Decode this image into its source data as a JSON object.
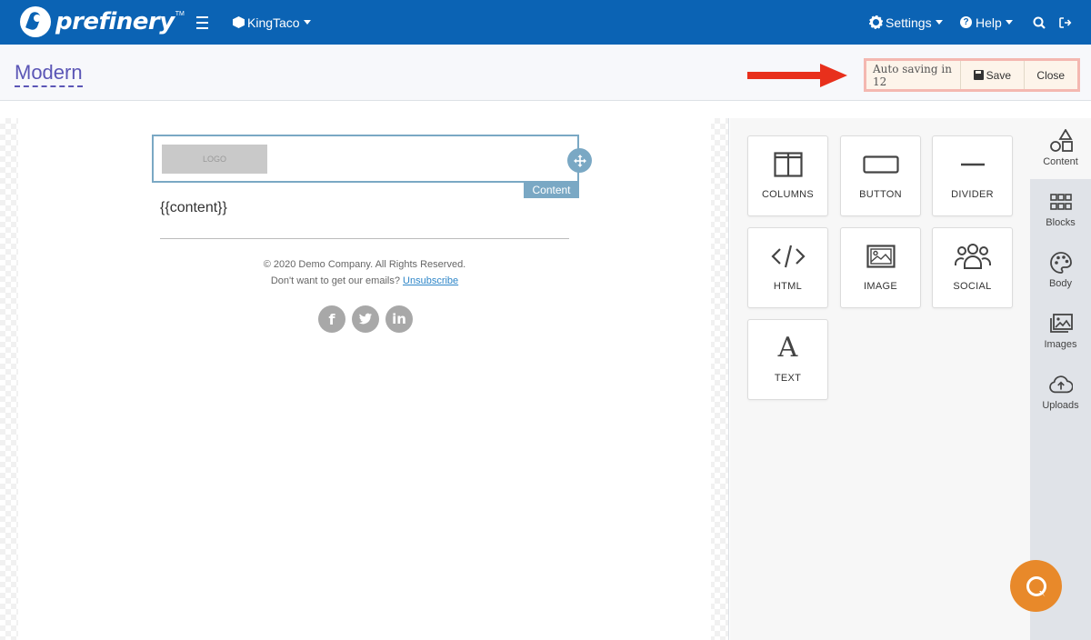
{
  "nav": {
    "brand": "prefinery",
    "brand_tm": "TM",
    "account": "KingTaco",
    "settings": "Settings",
    "help": "Help"
  },
  "header": {
    "title": "Modern",
    "autosave": "Auto saving in 12",
    "save_label": "Save",
    "close_label": "Close"
  },
  "email": {
    "logo_text": "LOGO",
    "content_tag": "Content",
    "content_placeholder": "{{content}}",
    "copyright": "© 2020 Demo Company. All Rights Reserved.",
    "unsubscribe_prefix": "Don't want to get our emails?",
    "unsubscribe_link": "Unsubscribe",
    "social": [
      "facebook-icon",
      "twitter-icon",
      "linkedin-icon"
    ]
  },
  "tools": [
    {
      "label": "COLUMNS",
      "icon": "columns-icon"
    },
    {
      "label": "BUTTON",
      "icon": "button-icon"
    },
    {
      "label": "DIVIDER",
      "icon": "divider-icon"
    },
    {
      "label": "HTML",
      "icon": "code-icon"
    },
    {
      "label": "IMAGE",
      "icon": "image-icon"
    },
    {
      "label": "SOCIAL",
      "icon": "users-icon"
    },
    {
      "label": "TEXT",
      "icon": "text-icon"
    }
  ],
  "sidebar": {
    "tabs": [
      {
        "label": "Content",
        "icon": "shapes-icon",
        "active": true
      },
      {
        "label": "Blocks",
        "icon": "grid-icon"
      },
      {
        "label": "Body",
        "icon": "palette-icon"
      },
      {
        "label": "Images",
        "icon": "images-icon"
      },
      {
        "label": "Uploads",
        "icon": "cloud-upload-icon"
      }
    ]
  },
  "colors": {
    "nav_bg": "#0b63b4",
    "title": "#5b56b6",
    "selection": "#7aa8c4",
    "arrow": "#e8301c",
    "help_bubble": "#e8892a"
  }
}
